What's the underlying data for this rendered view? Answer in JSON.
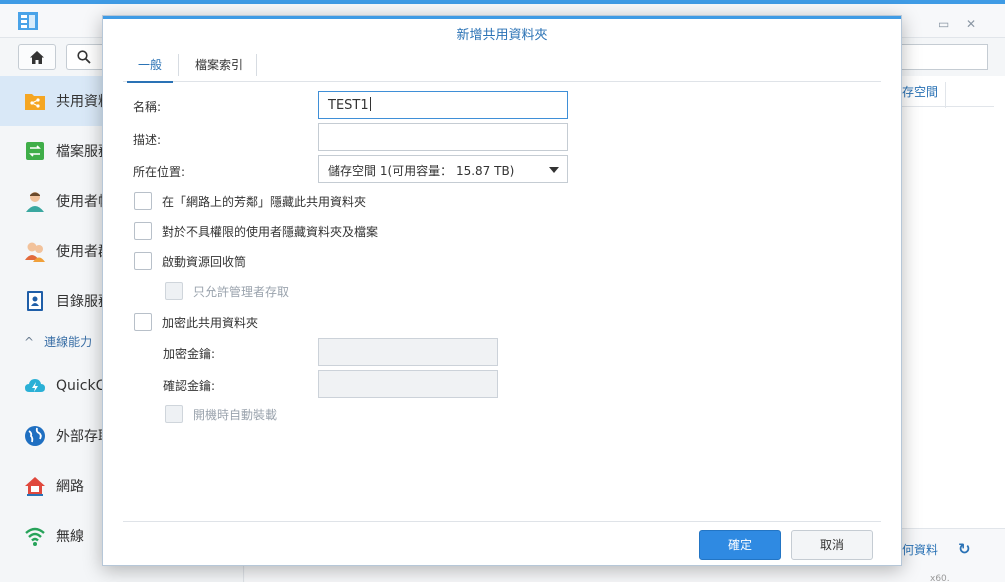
{
  "background": {
    "sidebar": {
      "items": [
        {
          "label": "共用資料",
          "icon": "shared-folder-icon"
        },
        {
          "label": "檔案服務",
          "icon": "file-services-icon"
        },
        {
          "label": "使用者帳",
          "icon": "user-icon"
        },
        {
          "label": "使用者群",
          "icon": "group-icon"
        },
        {
          "label": "目錄服務",
          "icon": "directory-icon"
        }
      ],
      "section_label": "連線能力",
      "section_items": [
        {
          "label": "QuickC",
          "icon": "quickconnect-icon"
        },
        {
          "label": "外部存取",
          "icon": "external-access-icon"
        },
        {
          "label": "網路",
          "icon": "network-icon"
        },
        {
          "label": "無線",
          "icon": "wireless-icon"
        }
      ]
    },
    "column_header": "存空間",
    "footer_text": "何資料",
    "footer_tail": "x60."
  },
  "dialog": {
    "title": "新增共用資料夾",
    "tabs": [
      {
        "label": "一般",
        "active": true
      },
      {
        "label": "檔案索引",
        "active": false
      }
    ],
    "fields": {
      "name_label": "名稱:",
      "name_value": "TEST1",
      "desc_label": "描述:",
      "desc_value": "",
      "location_label": "所在位置:",
      "location_value": "儲存空間 1(可用容量： 15.87 TB)"
    },
    "checkboxes": {
      "hide_network": "在「網路上的芳鄰」隱藏此共用資料夾",
      "hide_unauthorized": "對於不具權限的使用者隱藏資料夾及檔案",
      "recycle_bin": "啟動資源回收筒",
      "admin_only": "只允許管理者存取",
      "encrypt": "加密此共用資料夾",
      "auto_mount": "開機時自動裝載"
    },
    "encryption": {
      "key_label": "加密金鑰:",
      "confirm_label": "確認金鑰:"
    },
    "buttons": {
      "ok": "確定",
      "cancel": "取消"
    }
  },
  "colors": {
    "accent": "#2f8ae2",
    "title_blue": "#2a72b5",
    "top_strip": "#3f9be5"
  }
}
